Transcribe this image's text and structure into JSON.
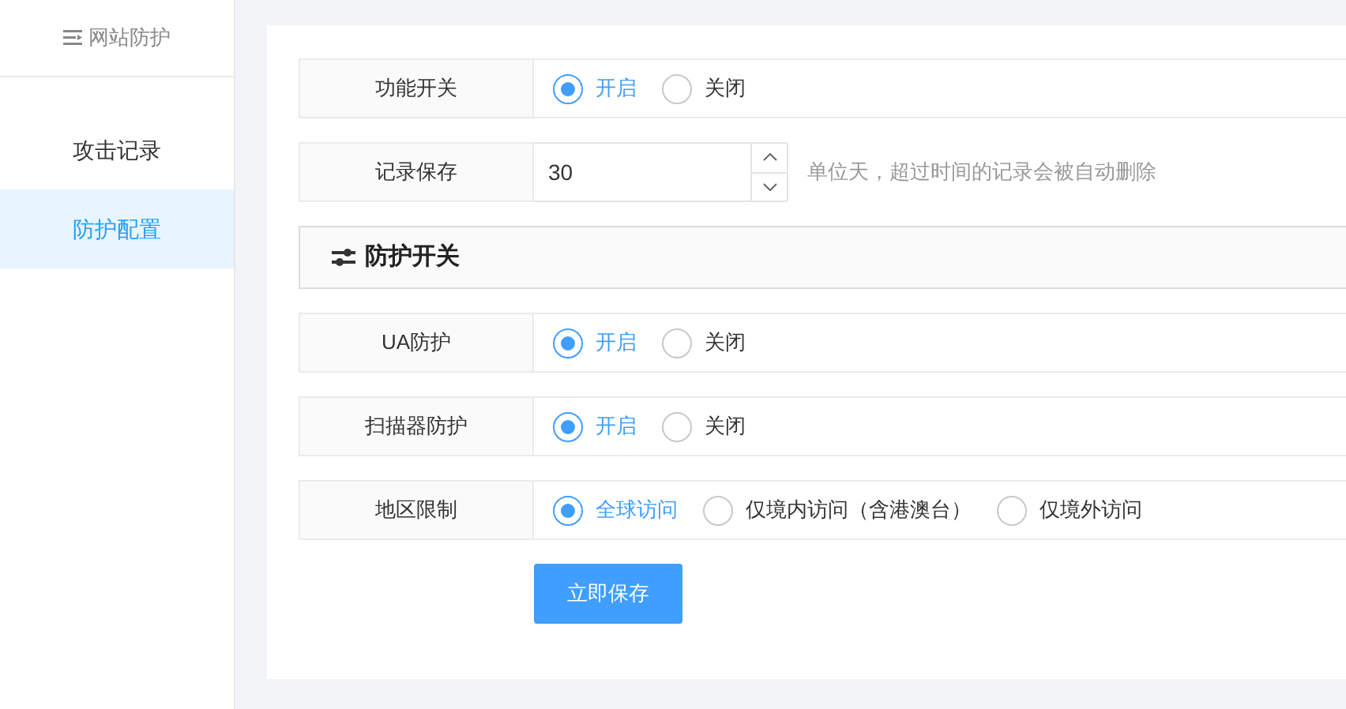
{
  "sidebar": {
    "title": "网站防护",
    "items": [
      {
        "label": "攻击记录",
        "selected": false
      },
      {
        "label": "防护配置",
        "selected": true
      }
    ]
  },
  "form": [
    {
      "kind": "radio",
      "label": "功能开关",
      "options": [
        {
          "label": "开启",
          "selected": true
        },
        {
          "label": "关闭",
          "selected": false
        }
      ]
    },
    {
      "kind": "number",
      "label": "记录保存",
      "value": "30",
      "hint": "单位天，超过时间的记录会被自动删除"
    },
    {
      "kind": "section",
      "label": "防护开关"
    },
    {
      "kind": "radio",
      "label": "UA防护",
      "options": [
        {
          "label": "开启",
          "selected": true
        },
        {
          "label": "关闭",
          "selected": false
        }
      ]
    },
    {
      "kind": "radio",
      "label": "扫描器防护",
      "options": [
        {
          "label": "开启",
          "selected": true
        },
        {
          "label": "关闭",
          "selected": false
        }
      ]
    },
    {
      "kind": "radio",
      "label": "地区限制",
      "options": [
        {
          "label": "全球访问",
          "selected": true
        },
        {
          "label": "仅境内访问（含港澳台）",
          "selected": false
        },
        {
          "label": "仅境外访问",
          "selected": false
        }
      ]
    }
  ],
  "save_button": "立即保存"
}
